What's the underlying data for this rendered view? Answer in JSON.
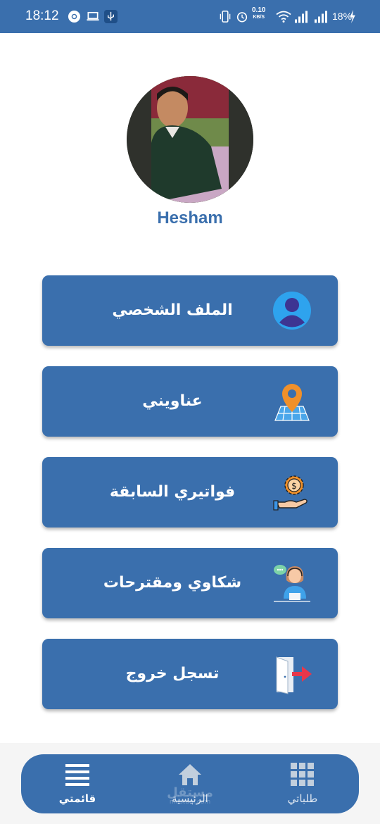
{
  "status_bar": {
    "time": "18:12",
    "speed_value": "0.10",
    "speed_unit": "KB/S",
    "battery": "18%",
    "icons": [
      "chrome-icon",
      "laptop-icon",
      "usb-icon",
      "vibrate-icon",
      "alarm-icon",
      "wifi-icon",
      "signal-icon",
      "signal-icon",
      "charging-icon"
    ]
  },
  "profile": {
    "name": "Hesham"
  },
  "menu": [
    {
      "label": "الملف الشخصي",
      "icon": "user-icon"
    },
    {
      "label": "عناويني",
      "icon": "location-map-icon"
    },
    {
      "label": "فواتيري السابقة",
      "icon": "payment-hand-icon"
    },
    {
      "label": "شكاوي ومقترحات",
      "icon": "support-agent-icon"
    },
    {
      "label": "تسجل خروج",
      "icon": "logout-door-icon"
    }
  ],
  "bottom_nav": [
    {
      "label": "قائمتي",
      "icon": "hamburger-icon",
      "active": true
    },
    {
      "label": "الرئيسية",
      "icon": "home-icon",
      "active": false
    },
    {
      "label": "طلباتي",
      "icon": "grid-icon",
      "active": false
    }
  ],
  "watermark": {
    "text": "مستقل",
    "sub": "mostaql.com"
  },
  "colors": {
    "primary": "#3a6fad",
    "accent_red": "#e8374a",
    "accent_orange": "#f0902a"
  }
}
